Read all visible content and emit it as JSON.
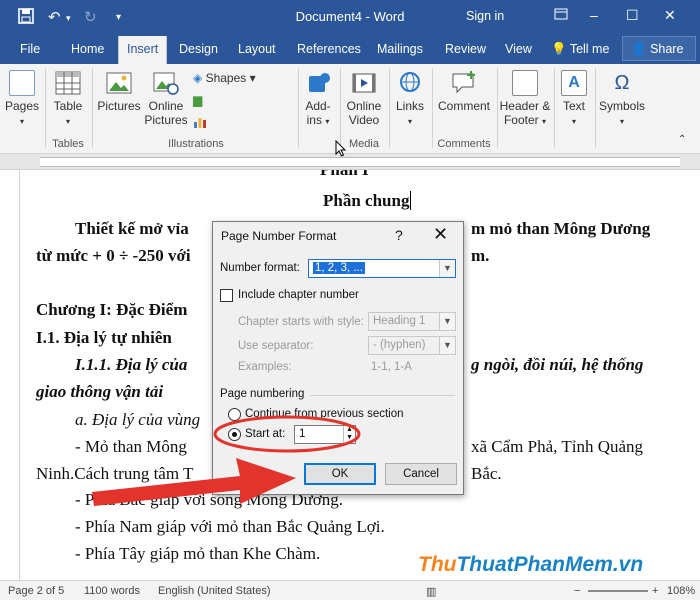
{
  "window": {
    "title": "Document4 - Word",
    "sign_in": "Sign in",
    "minimize": "–",
    "restore": "☐",
    "close": "✕"
  },
  "tabs": [
    {
      "label": "File"
    },
    {
      "label": "Home"
    },
    {
      "label": "Insert"
    },
    {
      "label": "Design"
    },
    {
      "label": "Layout"
    },
    {
      "label": "References"
    },
    {
      "label": "Mailings"
    },
    {
      "label": "Review"
    },
    {
      "label": "View"
    },
    {
      "label": "Tell me"
    }
  ],
  "share_label": "Share",
  "ribbon": {
    "pages": "Pages",
    "table": "Table",
    "pictures": "Pictures",
    "online_pictures_1": "Online",
    "online_pictures_2": "Pictures",
    "shapes": "Shapes",
    "addins_1": "Add-",
    "addins_2": "ins",
    "online_video_1": "Online",
    "online_video_2": "Video",
    "links": "Links",
    "comment": "Comment",
    "header_footer_1": "Header &",
    "header_footer_2": "Footer",
    "text": "Text",
    "symbols": "Symbols",
    "group_tables": "Tables",
    "group_illustrations": "Illustrations",
    "group_media": "Media",
    "group_comments": "Comments"
  },
  "document": {
    "heading_partial": "Phần I",
    "heading": "Phần chung",
    "p1_a": "Thiết kế mở vỉa",
    "p1_b": "m mỏ than Mông Dương",
    "p2_a": "từ mức + 0 ÷ -250 với",
    "p2_b": "m.",
    "chapter": "Chương I: Đặc Điểm",
    "section": "I.1. Địa lý tự  nhiên",
    "sub_a": "I.1.1. Địa lý của",
    "sub_b": "g ngòi, đồi núi, hệ thống",
    "sub2": "giao thông vận tải",
    "item_a": "a. Địa lý của vùng",
    "bullet1_a": "- Mỏ than Mông",
    "bullet1_b": "xã Cẩm Phả, Tỉnh Quảng",
    "bullet2_a": "Ninh.Cách trung tâm T",
    "bullet2_b": "Bắc.",
    "bullet3": "- Phía Bắc giáp với sông Mông Dương.",
    "bullet4": "- Phía Nam giáp với mỏ than Bắc Quảng Lợi.",
    "bullet5": "- Phía Tây giáp mỏ than Khe Chàm."
  },
  "dialog": {
    "title": "Page Number Format",
    "help": "?",
    "close": "✕",
    "number_format_label": "Number format:",
    "number_format_value": "1, 2, 3, ...",
    "include_chapter_label": "Include chapter number",
    "include_chapter_checked": false,
    "chapter_starts_label": "Chapter starts with style:",
    "chapter_starts_value": "Heading 1",
    "use_separator_label": "Use separator:",
    "use_separator_value": "-   (hyphen)",
    "examples_label": "Examples:",
    "examples_value": "1-1, 1-A",
    "page_numbering_label": "Page numbering",
    "continue_label": "Continue from previous section",
    "start_at_label": "Start at:",
    "start_at_value": "1",
    "selected_option": "start_at",
    "ok_label": "OK",
    "cancel_label": "Cancel"
  },
  "status": {
    "page": "Page 2 of 5",
    "words": "1100 words",
    "language": "English (United States)",
    "zoom": "108%"
  },
  "watermark": {
    "part1": "Thu",
    "part2": "Thuat",
    "part3": "PhanMem.vn"
  },
  "colors": {
    "title_bar": "#2b579a",
    "annotation_red": "#e2332c",
    "dialog_accent": "#0078d7"
  }
}
